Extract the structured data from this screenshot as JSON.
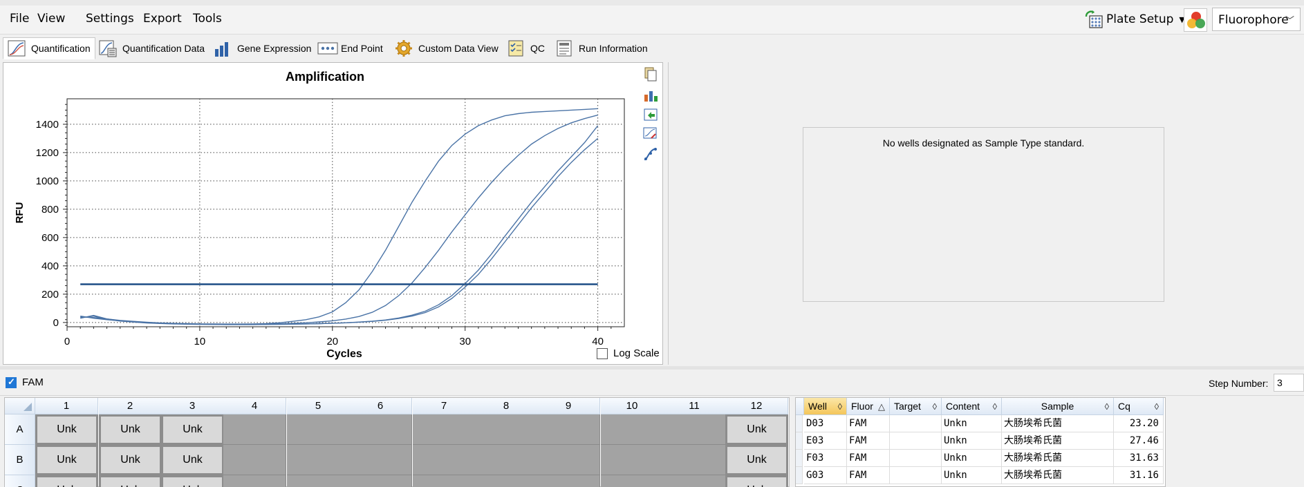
{
  "menu": {
    "file": "File",
    "view": "View",
    "settings": "Settings",
    "export": "Export",
    "tools": "Tools"
  },
  "toolbar": {
    "plate_setup": "Plate Setup",
    "fluorophore": "Fluorophore"
  },
  "tabs": [
    {
      "label": "Quantification"
    },
    {
      "label": "Quantification Data"
    },
    {
      "label": "Gene Expression"
    },
    {
      "label": "End Point"
    },
    {
      "label": "Custom Data View"
    },
    {
      "label": "QC"
    },
    {
      "label": "Run Information"
    }
  ],
  "chart_data": {
    "type": "line",
    "title": "Amplification",
    "xlabel": "Cycles",
    "ylabel": "RFU",
    "xlim": [
      0,
      42
    ],
    "ylim": [
      -30,
      1580
    ],
    "xticks": [
      0,
      10,
      20,
      30,
      40
    ],
    "yticks": [
      0,
      200,
      400,
      600,
      800,
      1000,
      1200,
      1400
    ],
    "grid": true,
    "threshold": 270,
    "series": [
      {
        "well": "D03",
        "color": "#4a73a6",
        "x": [
          1,
          2,
          3,
          4,
          5,
          6,
          7,
          8,
          9,
          10,
          11,
          12,
          13,
          14,
          15,
          16,
          17,
          18,
          19,
          20,
          21,
          22,
          23,
          24,
          25,
          26,
          27,
          28,
          29,
          30,
          31,
          32,
          33,
          34,
          35,
          36,
          37,
          38,
          39,
          40
        ],
        "values": [
          40,
          35,
          25,
          15,
          8,
          2,
          -3,
          -6,
          -8,
          -10,
          -10,
          -11,
          -11,
          -10,
          -8,
          -2,
          8,
          20,
          40,
          75,
          140,
          230,
          360,
          510,
          680,
          850,
          1000,
          1140,
          1250,
          1330,
          1390,
          1430,
          1460,
          1475,
          1485,
          1490,
          1495,
          1500,
          1505,
          1510
        ]
      },
      {
        "well": "E03",
        "color": "#4a73a6",
        "x": [
          1,
          2,
          3,
          4,
          5,
          6,
          7,
          8,
          9,
          10,
          11,
          12,
          13,
          14,
          15,
          16,
          17,
          18,
          19,
          20,
          21,
          22,
          23,
          24,
          25,
          26,
          27,
          28,
          29,
          30,
          31,
          32,
          33,
          34,
          35,
          36,
          37,
          38,
          39,
          40
        ],
        "values": [
          45,
          30,
          20,
          12,
          5,
          -1,
          -5,
          -8,
          -10,
          -11,
          -12,
          -12,
          -12,
          -12,
          -11,
          -9,
          -6,
          -2,
          4,
          12,
          24,
          42,
          72,
          120,
          190,
          280,
          390,
          510,
          640,
          760,
          880,
          990,
          1090,
          1180,
          1260,
          1320,
          1370,
          1410,
          1440,
          1465
        ]
      },
      {
        "well": "F03",
        "color": "#4a73a6",
        "x": [
          1,
          2,
          3,
          4,
          5,
          6,
          7,
          8,
          9,
          10,
          11,
          12,
          13,
          14,
          15,
          16,
          17,
          18,
          19,
          20,
          21,
          22,
          23,
          24,
          25,
          26,
          27,
          28,
          29,
          30,
          31,
          32,
          33,
          34,
          35,
          36,
          37,
          38,
          39,
          40
        ],
        "values": [
          30,
          50,
          25,
          12,
          4,
          -2,
          -6,
          -9,
          -11,
          -12,
          -13,
          -14,
          -14,
          -14,
          -13,
          -12,
          -11,
          -10,
          -8,
          -5,
          -2,
          2,
          8,
          16,
          28,
          45,
          70,
          110,
          170,
          250,
          340,
          450,
          570,
          690,
          810,
          920,
          1030,
          1130,
          1220,
          1300
        ]
      },
      {
        "well": "G03",
        "color": "#4a73a6",
        "x": [
          1,
          2,
          3,
          4,
          5,
          6,
          7,
          8,
          9,
          10,
          11,
          12,
          13,
          14,
          15,
          16,
          17,
          18,
          19,
          20,
          21,
          22,
          23,
          24,
          25,
          26,
          27,
          28,
          29,
          30,
          31,
          32,
          33,
          34,
          35,
          36,
          37,
          38,
          39,
          40
        ],
        "values": [
          35,
          45,
          22,
          10,
          3,
          -3,
          -7,
          -10,
          -12,
          -13,
          -14,
          -15,
          -15,
          -15,
          -14,
          -13,
          -12,
          -10,
          -8,
          -5,
          -2,
          3,
          9,
          18,
          32,
          52,
          80,
          125,
          190,
          275,
          370,
          485,
          610,
          730,
          850,
          960,
          1070,
          1170,
          1270,
          1390
        ]
      }
    ]
  },
  "chart_panel": {
    "log_scale_label": "Log Scale",
    "no_standard_msg": "No wells designated as Sample Type standard."
  },
  "fam_row": {
    "fam_label": "FAM",
    "step_label": "Step Number:",
    "step_value": "3"
  },
  "plate": {
    "columns": [
      "1",
      "2",
      "3",
      "4",
      "5",
      "6",
      "7",
      "8",
      "9",
      "10",
      "11",
      "12"
    ],
    "rows": [
      {
        "label": "A",
        "wells": [
          "Unk",
          "Unk",
          "Unk",
          "",
          "",
          "",
          "",
          "",
          "",
          "",
          "",
          "Unk"
        ]
      },
      {
        "label": "B",
        "wells": [
          "Unk",
          "Unk",
          "Unk",
          "",
          "",
          "",
          "",
          "",
          "",
          "",
          "",
          "Unk"
        ]
      },
      {
        "label": "C",
        "wells": [
          "Unk",
          "Unk",
          "Unk",
          "",
          "",
          "",
          "",
          "",
          "",
          "",
          "",
          "Unk"
        ]
      }
    ]
  },
  "table": {
    "headers": [
      "Well",
      "Fluor",
      "Target",
      "Content",
      "Sample",
      "Cq"
    ],
    "rows": [
      {
        "well": "D03",
        "fluor": "FAM",
        "target": "",
        "content": "Unkn",
        "sample": "大肠埃希氏菌",
        "cq": "23.20"
      },
      {
        "well": "E03",
        "fluor": "FAM",
        "target": "",
        "content": "Unkn",
        "sample": "大肠埃希氏菌",
        "cq": "27.46"
      },
      {
        "well": "F03",
        "fluor": "FAM",
        "target": "",
        "content": "Unkn",
        "sample": "大肠埃希氏菌",
        "cq": "31.63"
      },
      {
        "well": "G03",
        "fluor": "FAM",
        "target": "",
        "content": "Unkn",
        "sample": "大肠埃希氏菌",
        "cq": "31.16"
      }
    ]
  }
}
